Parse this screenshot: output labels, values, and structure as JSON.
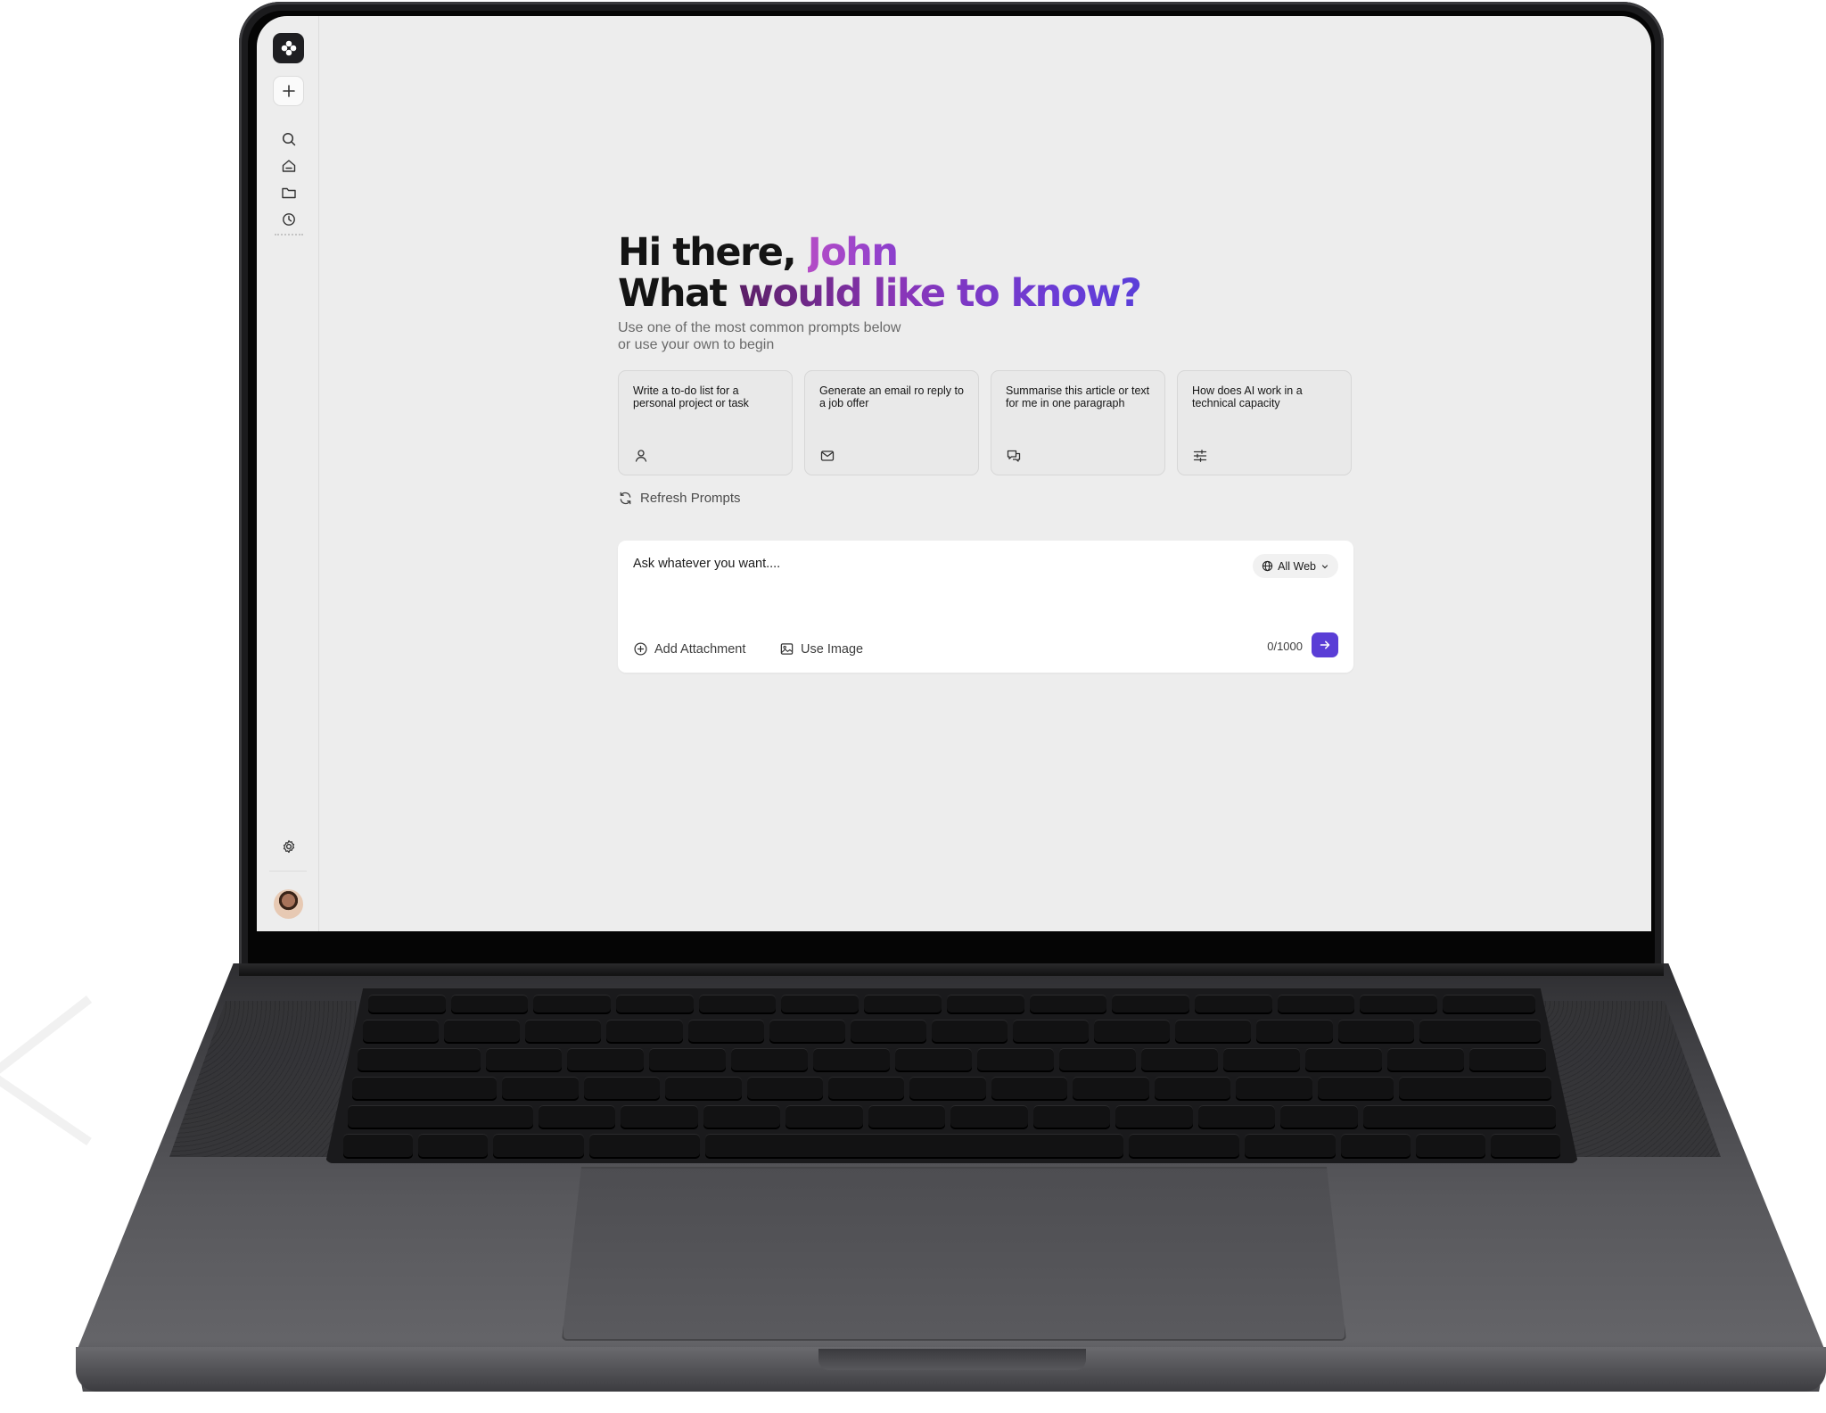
{
  "colors": {
    "accent": "#5a3ed6",
    "name_gradient_start": "#b44cc6",
    "question_gradient_end": "#5a3ed8",
    "screen_background": "#ededed",
    "card_background": "#e9e9e9"
  },
  "sidebar": {
    "logo_icon": "app-logo-icon",
    "new_chat_icon": "plus-icon",
    "nav_icons": [
      "search-icon",
      "home-icon",
      "folder-icon",
      "history-icon"
    ],
    "settings_icon": "gear-icon",
    "avatar": "user-avatar"
  },
  "greeting": {
    "prefix": "Hi there, ",
    "name": "John",
    "question_plain": "What ",
    "question_highlight": "would like to know?"
  },
  "subtitle": "Use one of the most common prompts below or use your own to begin",
  "prompts": [
    {
      "text": "Write a to-do list for a personal project or task",
      "icon": "user-icon"
    },
    {
      "text": "Generate an email ro reply to a job offer",
      "icon": "mail-icon"
    },
    {
      "text": "Summarise this article or text for me in one paragraph",
      "icon": "chat-icon"
    },
    {
      "text": "How does AI work in a technical capacity",
      "icon": "sliders-icon"
    }
  ],
  "refresh_label": "Refresh Prompts",
  "composer": {
    "placeholder": "Ask whatever you want....",
    "source_label": "All Web",
    "attachment_label": "Add Attachment",
    "image_label": "Use Image",
    "counter": "0/1000"
  }
}
